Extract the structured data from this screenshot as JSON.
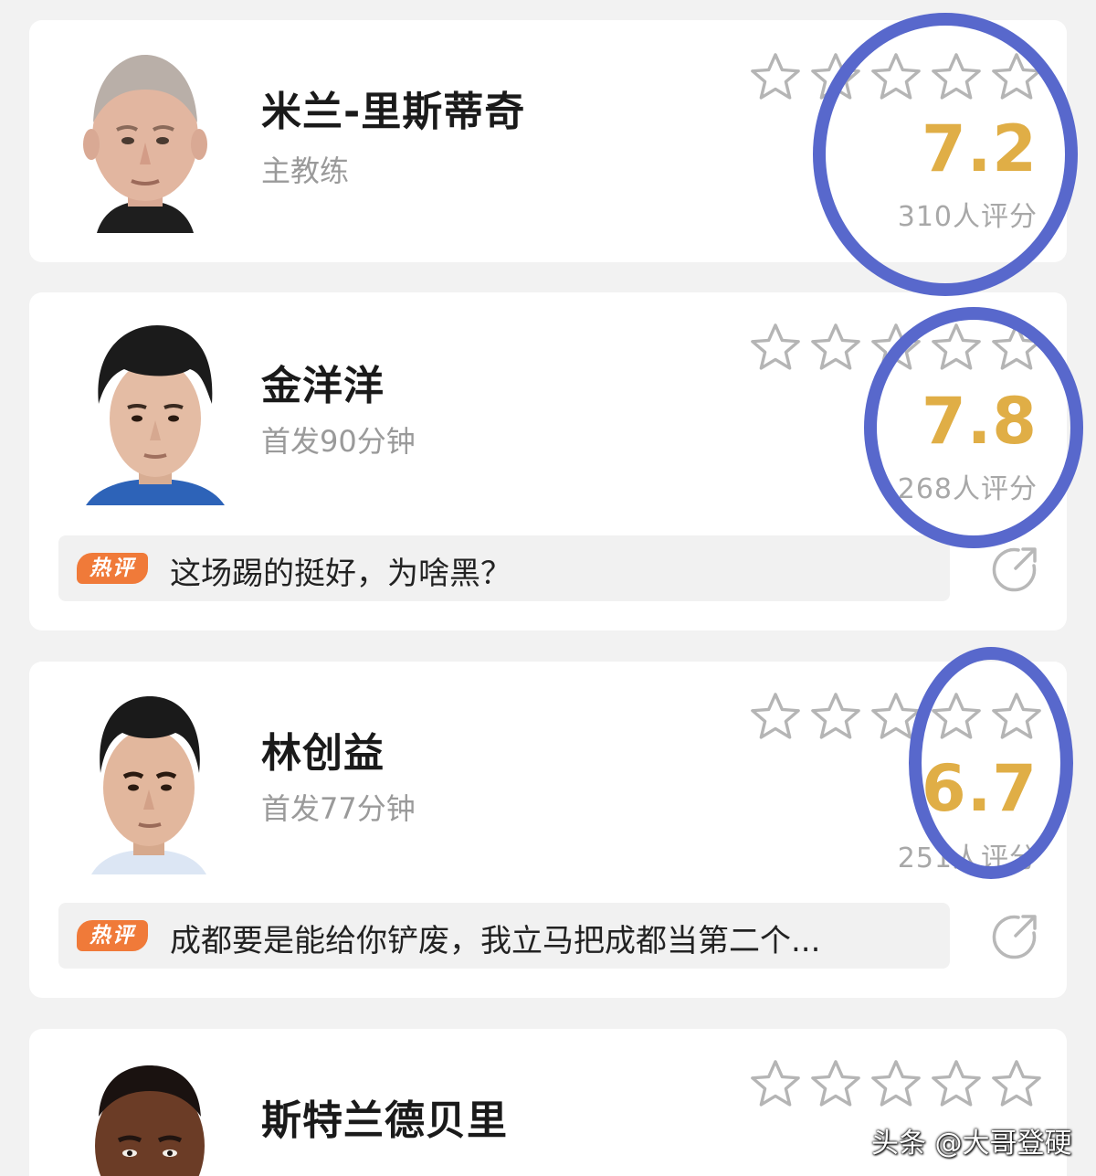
{
  "colors": {
    "score": "#e0ae46",
    "hot_badge": "#f07a39",
    "circle_annotation": "#5868cc",
    "star_outline": "#b5b5b5"
  },
  "cards": [
    {
      "name": "米兰-里斯蒂奇",
      "subtitle": "主教练",
      "score": "7.2",
      "rating_count": "310人评分",
      "stars_filled": 0,
      "avatar_icon": "coach-portrait"
    },
    {
      "name": "金洋洋",
      "subtitle": "首发90分钟",
      "score": "7.8",
      "rating_count": "268人评分",
      "stars_filled": 0,
      "avatar_icon": "player-portrait",
      "comment": {
        "badge": "热评",
        "text": "这场踢的挺好，为啥黑？"
      }
    },
    {
      "name": "林创益",
      "subtitle": "首发77分钟",
      "score": "6.7",
      "rating_count": "251人评分",
      "stars_filled": 0,
      "avatar_icon": "player-portrait",
      "comment": {
        "badge": "热评",
        "text": "成都要是能给你铲废，我立马把成都当第二个..."
      }
    },
    {
      "name": "斯特兰德贝里",
      "stars_filled": 0,
      "avatar_icon": "player-portrait"
    }
  ],
  "watermark": "头条 @大哥登硬"
}
